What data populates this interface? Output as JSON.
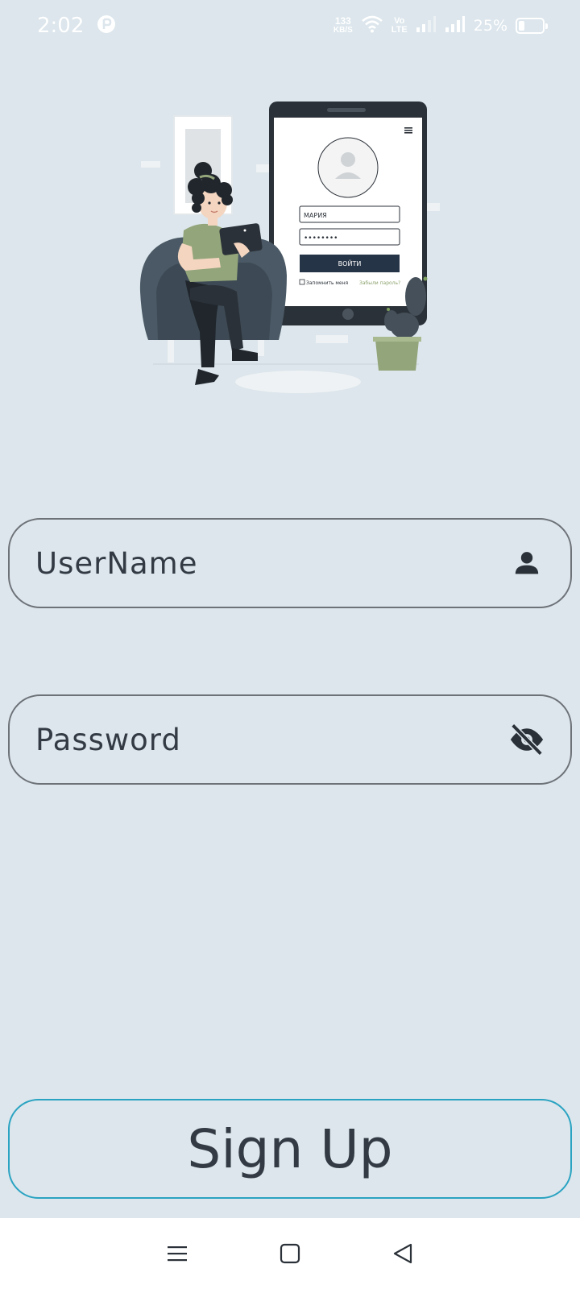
{
  "status_bar": {
    "time": "2:02",
    "net_speed_value": "133",
    "net_speed_unit": "KB/S",
    "volte_top": "Vo",
    "volte_bottom": "LTE",
    "battery_percent": "25%",
    "battery_level": 0.25
  },
  "illustration": {
    "screen_name": "МАРИЯ",
    "screen_password": "••••••••",
    "screen_button": "ВОЙТИ",
    "screen_remember": "Запомнить меня",
    "screen_forgot": "Забыли пароль?"
  },
  "form": {
    "username_placeholder": "UserName",
    "password_placeholder": "Password",
    "signup_label": "Sign Up"
  },
  "icons": {
    "username": "person-icon",
    "password": "eye-off-icon",
    "nav_recents": "menu-icon",
    "nav_home": "square-icon",
    "nav_back": "triangle-back-icon"
  },
  "colors": {
    "background": "#dce6ec",
    "signup_border": "#2aa3c2",
    "field_border": "#6d7278",
    "text": "#333a44"
  }
}
